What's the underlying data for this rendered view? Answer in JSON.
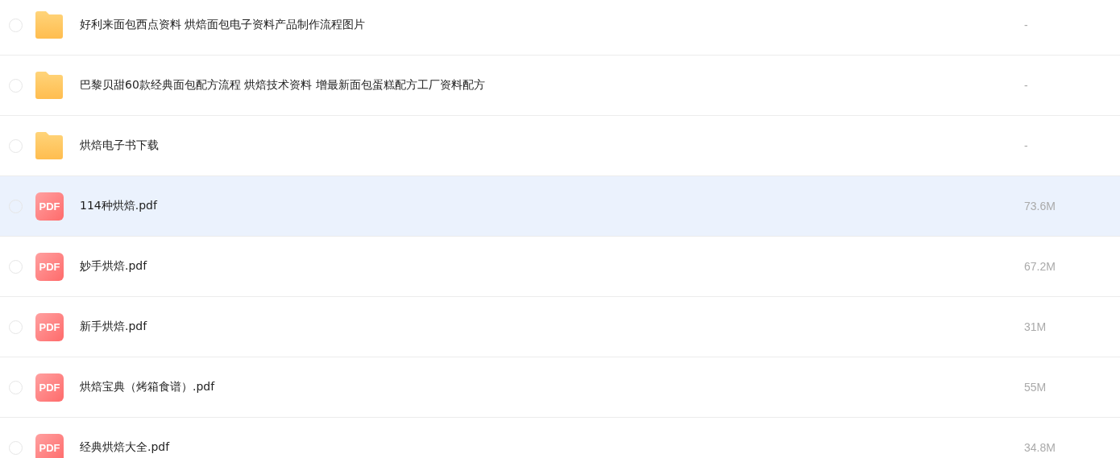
{
  "files": [
    {
      "kind": "folder",
      "name": "好利来面包西点资料 烘焙面包电子资料产品制作流程图片",
      "size": "-",
      "selected": false
    },
    {
      "kind": "folder",
      "name": "巴黎贝甜60款经典面包配方流程 烘焙技术资料 增最新面包蛋糕配方工厂资料配方",
      "size": "-",
      "selected": false
    },
    {
      "kind": "folder",
      "name": "烘焙电子书下载",
      "size": "-",
      "selected": false
    },
    {
      "kind": "pdf",
      "badge": "PDF",
      "name": "114种烘焙.pdf",
      "size": "73.6M",
      "selected": true
    },
    {
      "kind": "pdf",
      "badge": "PDF",
      "name": "妙手烘焙.pdf",
      "size": "67.2M",
      "selected": false
    },
    {
      "kind": "pdf",
      "badge": "PDF",
      "name": "新手烘焙.pdf",
      "size": "31M",
      "selected": false
    },
    {
      "kind": "pdf",
      "badge": "PDF",
      "name": "烘焙宝典（烤箱食谱）.pdf",
      "size": "55M",
      "selected": false
    },
    {
      "kind": "pdf",
      "badge": "PDF",
      "name": "经典烘焙大全.pdf",
      "size": "34.8M",
      "selected": false
    }
  ]
}
